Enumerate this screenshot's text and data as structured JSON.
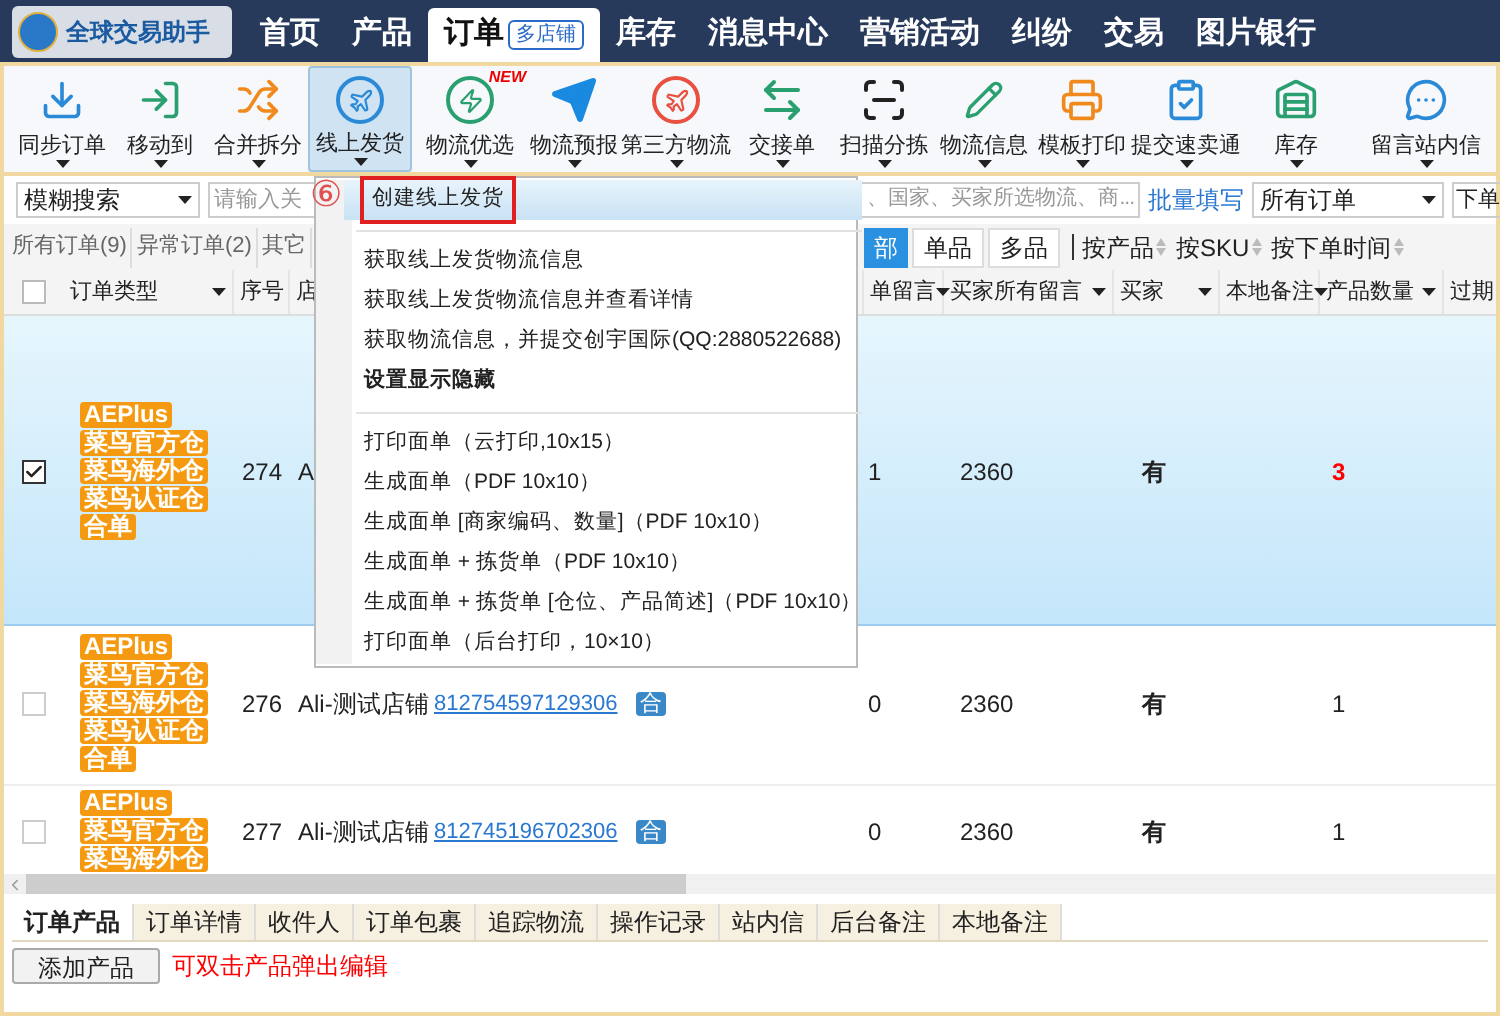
{
  "app": {
    "name": "全球交易助手"
  },
  "nav": [
    {
      "label": "首页",
      "selected": false
    },
    {
      "label": "产品",
      "selected": false
    },
    {
      "label": "订单",
      "selected": true,
      "badge": "多店铺"
    },
    {
      "label": "库存",
      "selected": false
    },
    {
      "label": "消息中心",
      "selected": false
    },
    {
      "label": "营销活动",
      "selected": false
    },
    {
      "label": "纠纷",
      "selected": false
    },
    {
      "label": "交易",
      "selected": false
    },
    {
      "label": "图片银行",
      "selected": false
    }
  ],
  "toolbar": [
    {
      "label": "同步订单",
      "selected": false
    },
    {
      "label": "移动到",
      "selected": false
    },
    {
      "label": "合并拆分",
      "selected": false
    },
    {
      "label": "线上发货",
      "selected": true
    },
    {
      "label": "物流优选",
      "selected": false,
      "badge": "NEW"
    },
    {
      "label": "物流预报",
      "selected": false
    },
    {
      "label": "第三方物流",
      "selected": false
    },
    {
      "label": "交接单",
      "selected": false
    },
    {
      "label": "扫描分拣",
      "selected": false
    },
    {
      "label": "物流信息",
      "selected": false
    },
    {
      "label": "模板打印",
      "selected": false
    },
    {
      "label": "提交速卖通",
      "selected": false
    },
    {
      "label": "库存",
      "selected": false
    },
    {
      "label": "留言站内信",
      "selected": false
    }
  ],
  "search": {
    "mode": "模糊搜索",
    "placeholder_start": "请输入关",
    "placeholder_end": "、国家、买家所选物流、商...",
    "batch_link": "批量填写",
    "order_filter": "所有订单",
    "sort_filter": "下单"
  },
  "status_tabs": [
    {
      "label": "所有订单(9)",
      "selected": false
    },
    {
      "label": "异常订单(2)",
      "selected": false
    },
    {
      "label": "其它",
      "selected": false
    }
  ],
  "type_tabs": [
    {
      "label": "部",
      "selected": true
    },
    {
      "label": "单品",
      "selected": false
    },
    {
      "label": "多品",
      "selected": false
    }
  ],
  "sort_options": [
    "按产品",
    "按SKU",
    "按下单时间"
  ],
  "table": {
    "checked": false,
    "columns": [
      "订单类型",
      "序号",
      "店",
      "",
      "",
      "单留言",
      "买家所有留言",
      "买家",
      "本地备注",
      "产品数量",
      "过期"
    ],
    "rows": [
      {
        "selected": true,
        "tags": [
          "AEPlus",
          "菜鸟官方仓",
          "菜鸟海外仓",
          "菜鸟认证仓",
          "合单"
        ],
        "seq": "274",
        "store": "A",
        "order_message": "1",
        "all_messages": "2360",
        "buyer": "有",
        "quantity": "3",
        "quantity_alert": true
      },
      {
        "selected": false,
        "tags": [
          "AEPlus",
          "菜鸟官方仓",
          "菜鸟海外仓",
          "菜鸟认证仓",
          "合单"
        ],
        "seq": "276",
        "store": "Ali-测试店铺",
        "order_no": "812754597129306",
        "merged": "合",
        "order_message": "0",
        "all_messages": "2360",
        "buyer": "有",
        "quantity": "1",
        "quantity_alert": false
      },
      {
        "selected": false,
        "tags": [
          "AEPlus",
          "菜鸟官方仓",
          "菜鸟海外仓"
        ],
        "seq": "277",
        "store": "Ali-测试店铺",
        "order_no": "812745196702306",
        "merged": "合",
        "order_message": "0",
        "all_messages": "2360",
        "buyer": "有",
        "quantity": "1",
        "quantity_alert": false
      }
    ]
  },
  "detail_tabs": [
    {
      "label": "订单产品",
      "selected": true
    },
    {
      "label": "订单详情",
      "selected": false
    },
    {
      "label": "收件人",
      "selected": false
    },
    {
      "label": "订单包裹",
      "selected": false
    },
    {
      "label": "追踪物流",
      "selected": false
    },
    {
      "label": "操作记录",
      "selected": false
    },
    {
      "label": "站内信",
      "selected": false
    },
    {
      "label": "后台备注",
      "selected": false
    },
    {
      "label": "本地备注",
      "selected": false
    }
  ],
  "add_product_button": "添加产品",
  "hint": "可双击产品弹出编辑",
  "annotation": "⑥",
  "menu": [
    {
      "kind": "item",
      "label": "创建线上发货",
      "selected": true,
      "emphasized": false
    },
    {
      "kind": "separator"
    },
    {
      "kind": "item",
      "label": "获取线上发货物流信息",
      "selected": false,
      "emphasized": false
    },
    {
      "kind": "item",
      "label": "获取线上发货物流信息并查看详情",
      "selected": false,
      "emphasized": false
    },
    {
      "kind": "item",
      "label": "获取物流信息，并提交创宇国际(QQ:2880522688)",
      "selected": false,
      "emphasized": false
    },
    {
      "kind": "item",
      "label": "设置显示隐藏",
      "selected": false,
      "emphasized": true
    },
    {
      "kind": "separator"
    },
    {
      "kind": "item",
      "label": "打印面单（云打印,10x15）",
      "selected": false,
      "emphasized": false
    },
    {
      "kind": "item",
      "label": "生成面单（PDF 10x10）",
      "selected": false,
      "emphasized": false
    },
    {
      "kind": "item",
      "label": "生成面单 [商家编码、数量]（PDF 10x10）",
      "selected": false,
      "emphasized": false
    },
    {
      "kind": "item",
      "label": "生成面单 + 拣货单（PDF 10x10）",
      "selected": false,
      "emphasized": false
    },
    {
      "kind": "item",
      "label": "生成面单 + 拣货单 [仓位、产品简述]（PDF 10x10）",
      "selected": false,
      "emphasized": false
    },
    {
      "kind": "item",
      "label": "打印面单（后台打印，10×10）",
      "selected": false,
      "emphasized": false
    }
  ]
}
